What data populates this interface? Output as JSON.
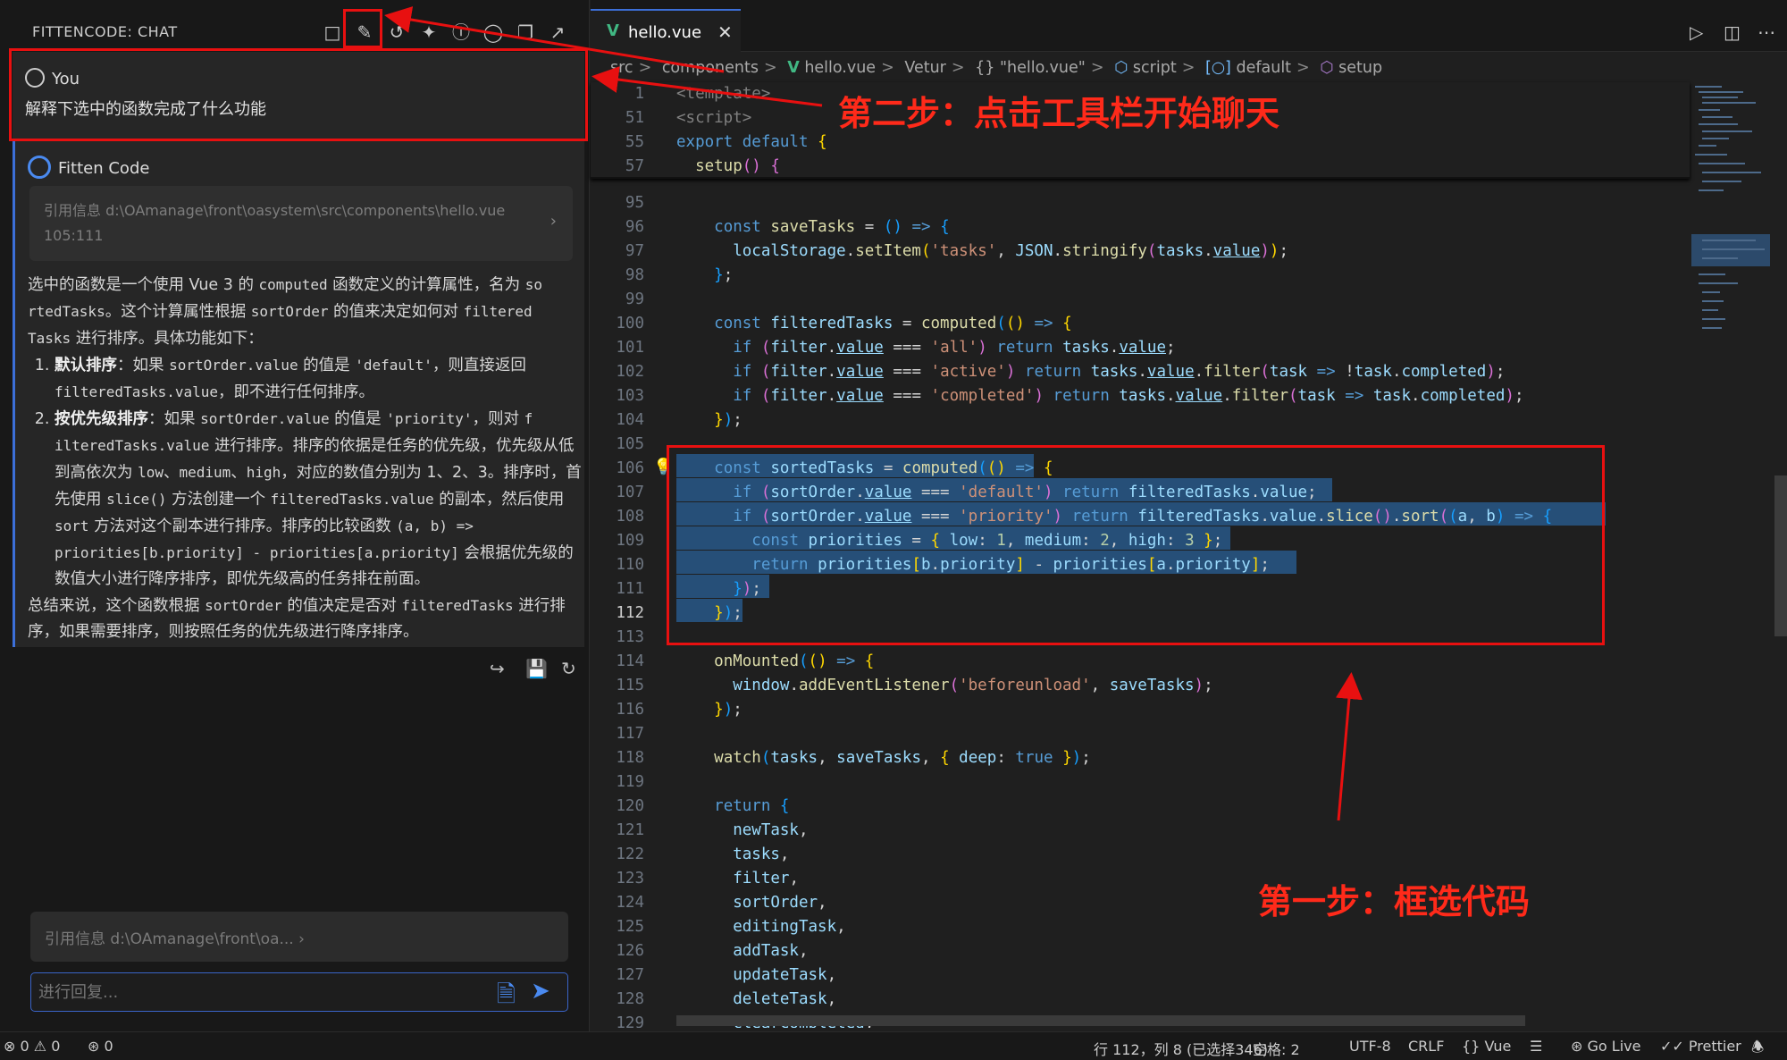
{
  "chat": {
    "title": "FITTENCODE: CHAT",
    "you_label": "You",
    "question": "解释下选中的函数完成了什么功能",
    "bot_label": "Fitten Code",
    "ref_line1": "引用信息 d:\\OAmanage\\front\\oasystem\\src\\components\\hello.vue",
    "ref_line2": "105:111",
    "answer_p1_a": "选中的函数是一个使用 Vue 3 的 ",
    "answer_p1_code1": "computed",
    "answer_p1_b": " 函数定义的计算属性，名为 ",
    "answer_p1_code2": "so rtedTasks",
    "answer_p1_c": "。这个计算属性根据 ",
    "answer_p1_code3": "sortOrder",
    "answer_p1_d": " 的值来决定如何对 ",
    "answer_p1_code4": "filtered Tasks",
    "answer_p1_e": " 进行排序。具体功能如下：",
    "li1_bold": "默认排序",
    "li1_a": "：如果 ",
    "li1_code1": "sortOrder.value",
    "li1_b": " 的值是 ",
    "li1_code2": "'default'",
    "li1_c": "，则直接返回 ",
    "li1_code3": "filteredTasks.value",
    "li1_d": "，即不进行任何排序。",
    "li2_bold": "按优先级排序",
    "li2_a": "：如果 ",
    "li2_code1": "sortOrder.value",
    "li2_b": " 的值是 ",
    "li2_code2": "'priority'",
    "li2_c": "，则对 ",
    "li2_code3": "f ilteredTasks.value",
    "li2_d": " 进行排序。排序的依据是任务的优先级，优先级从低到高依次为 ",
    "li2_code4": "low",
    "li2_e": "、",
    "li2_code5": "medium",
    "li2_f": "、",
    "li2_code6": "high",
    "li2_g": "，对应的数值分别为 1、2、3。排序时，首先使用 ",
    "li2_code7": "slice()",
    "li2_h": " 方法创建一个 ",
    "li2_code8": "filteredTasks.value",
    "li2_i": " 的副本，然后使用 ",
    "li2_code9": "sort",
    "li2_j": " 方法对这个副本进行排序。排序的比较函数 ",
    "li2_code10": "(a, b) => priorities[b.priority] - priorities[a.priority]",
    "li2_k": " 会根据优先级的数值大小进行降序排序，即优先级高的任务排在前面。",
    "summary_a": "总结来说，这个函数根据 ",
    "summary_code1": "sortOrder",
    "summary_b": " 的值决定是否对 ",
    "summary_code2": "filteredTasks",
    "summary_c": " 进行排序，如果需要排序，则按照任务的优先级进行降序排序。",
    "bottom_ref": "引用信息 d:\\OAmanage\\front\\oa...",
    "input_placeholder": "进行回复..."
  },
  "editor": {
    "tab_name": "hello.vue",
    "breadcrumb": [
      "src",
      "components",
      "hello.vue",
      "Vetur",
      "{} \"hello.vue\"",
      "script",
      "default",
      "setup"
    ]
  },
  "status": {
    "errors": "0",
    "warnings": "0",
    "ports": "0",
    "position": "行 112，列 8 (已选择346)",
    "spaces": "空格: 2",
    "encoding": "UTF-8",
    "eol": "CRLF",
    "language": "Vue",
    "golive": "Go Live",
    "prettier": "Prettier"
  },
  "annotations": {
    "step2": "第二步：点击工具栏开始聊天",
    "step1": "第一步：框选代码"
  },
  "colors": {
    "annotation_red": "#e81010",
    "accent_blue": "#3c6fd8",
    "vue_green": "#41b883",
    "selection": "#264f78"
  }
}
